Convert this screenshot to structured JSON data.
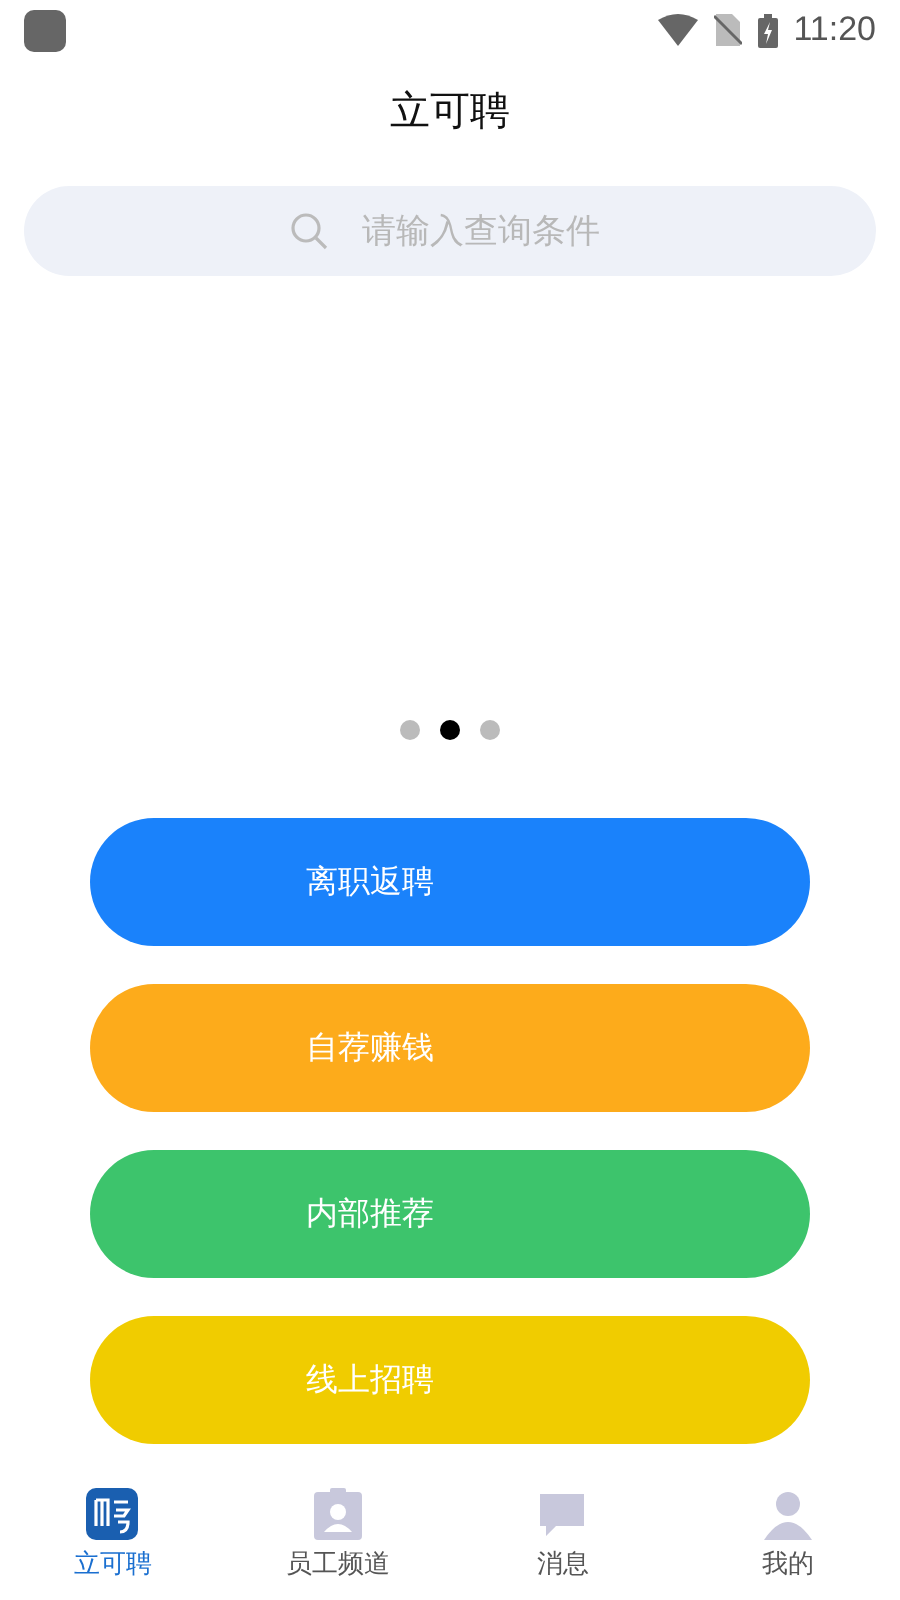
{
  "status_bar": {
    "time": "11:20"
  },
  "header": {
    "title": "立可聘"
  },
  "search": {
    "placeholder": "请输入查询条件"
  },
  "carousel": {
    "dots": [
      {
        "selected": false
      },
      {
        "selected": true
      },
      {
        "selected": false
      }
    ]
  },
  "actions": [
    {
      "label": "离职返聘",
      "color": "#1a82fb"
    },
    {
      "label": "自荐赚钱",
      "color": "#fdab1b"
    },
    {
      "label": "内部推荐",
      "color": "#3dc46c"
    },
    {
      "label": "线上招聘",
      "color": "#f0cc00"
    }
  ],
  "tab_bar": [
    {
      "label": "立可聘",
      "kind": "logo",
      "selected": true
    },
    {
      "label": "员工频道",
      "kind": "badge",
      "selected": false
    },
    {
      "label": "消息",
      "kind": "chat",
      "selected": false
    },
    {
      "label": "我的",
      "kind": "person",
      "selected": false
    }
  ]
}
